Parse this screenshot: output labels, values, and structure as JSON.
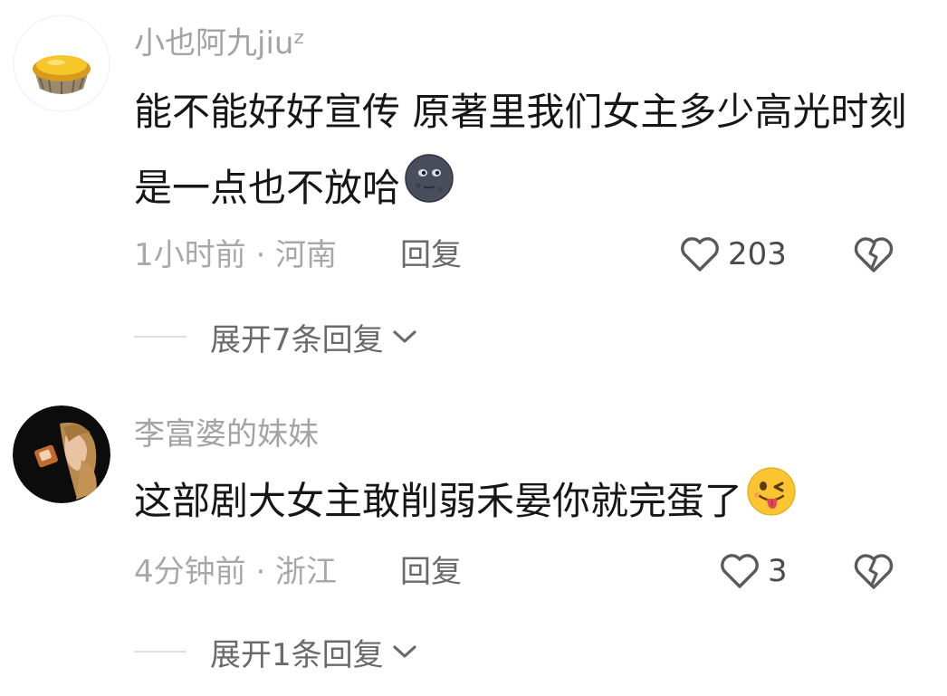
{
  "comments": [
    {
      "username": "小也阿九jiuᶻ",
      "avatar": "egg-tart-avatar",
      "text": "能不能好好宣传 原著里我们女主多少高光时刻是一点也不放哈",
      "emoji": "new-moon-face-emoji",
      "time_location": "1小时前 · 河南",
      "reply_label": "回复",
      "likes": "203",
      "expand_replies": "展开7条回复"
    },
    {
      "username": "李富婆的妹妹",
      "avatar": "girl-photo-avatar",
      "text": "这部剧大女主敢削弱禾晏你就完蛋了",
      "emoji": "winking-tongue-emoji",
      "time_location": "4分钟前 · 浙江",
      "reply_label": "回复",
      "likes": "3",
      "expand_replies": "展开1条回复"
    }
  ],
  "colors": {
    "username": "#a3a3a3",
    "body_text": "#161616",
    "meta": "#a8a8a8",
    "action": "#6a6a6a",
    "icon": "#5a5a5a"
  }
}
